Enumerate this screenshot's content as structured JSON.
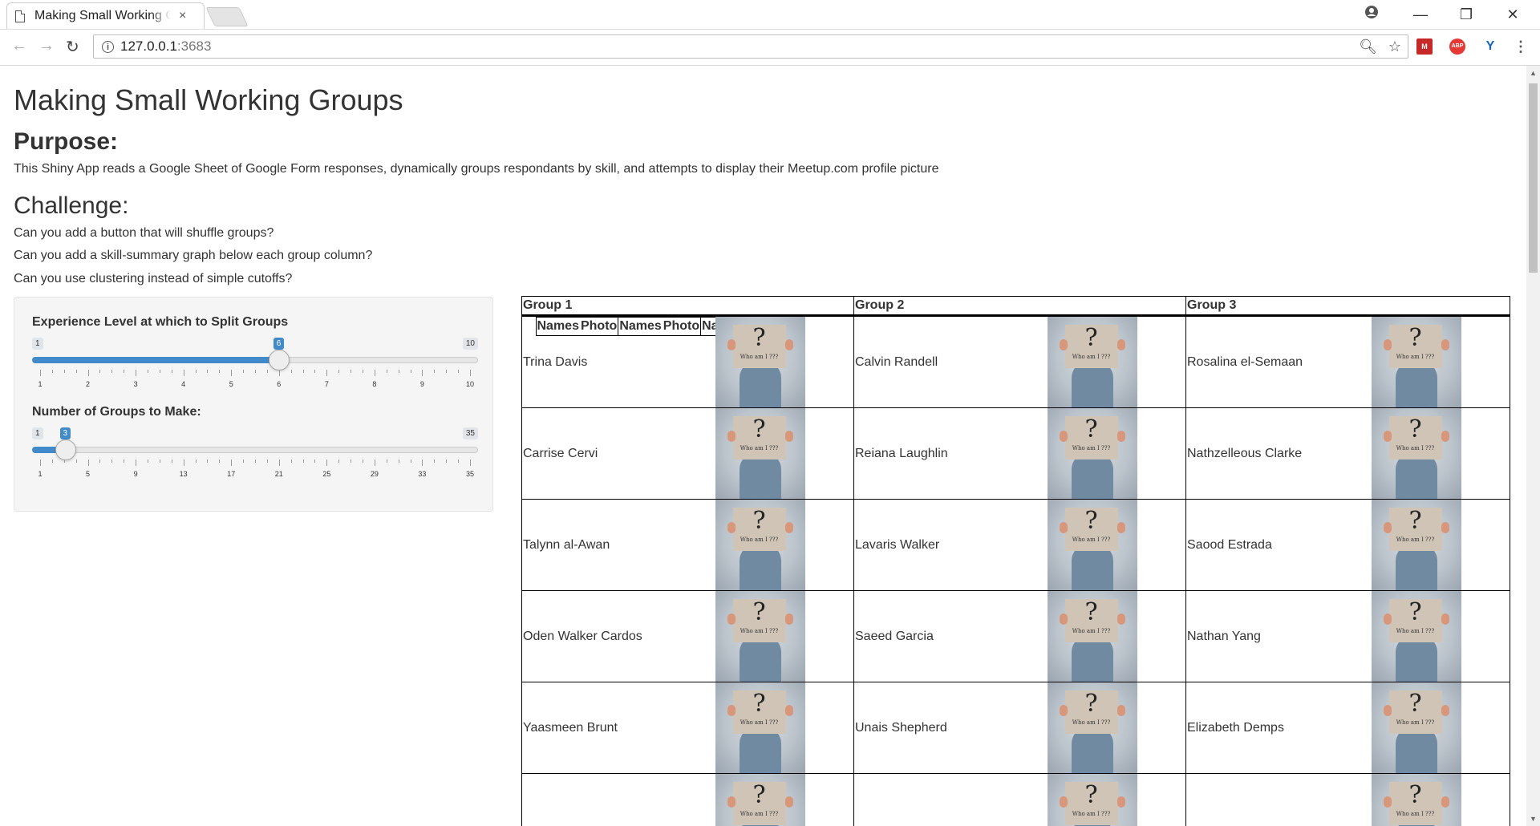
{
  "browser": {
    "tab_title": "Making Small Working G",
    "tab_close": "×",
    "url_host": "127.0.0.1",
    "url_port": ":3683",
    "ext_m": "M",
    "ext_abp": "ABP",
    "ext_y": "Y",
    "win_min": "—",
    "win_restore": "❐",
    "win_close": "✕"
  },
  "page": {
    "title": "Making Small Working Groups",
    "purpose_heading": "Purpose:",
    "purpose_text": "This Shiny App reads a Google Sheet of Google Form responses, dynamically groups respondants by skill, and attempts to display their Meetup.com profile picture",
    "challenge_heading": "Challenge:",
    "challenges": [
      "Can you add a button that will shuffle groups?",
      "Can you add a skill-summary graph below each group column?",
      "Can you use clustering instead of simple cutoffs?"
    ]
  },
  "sliders": [
    {
      "label": "Experience Level at which to Split Groups",
      "min": 1,
      "max": 10,
      "value": 6,
      "tick_labels": [
        "1",
        "2",
        "3",
        "4",
        "5",
        "6",
        "7",
        "8",
        "9",
        "10"
      ]
    },
    {
      "label": "Number of Groups to Make:",
      "min": 1,
      "max": 35,
      "value": 3,
      "tick_labels": [
        "1",
        "5",
        "9",
        "13",
        "17",
        "21",
        "25",
        "29",
        "33",
        "35"
      ]
    }
  ],
  "table": {
    "group_headers": [
      "Group 1",
      "Group 2",
      "Group 3"
    ],
    "col_names": "Names",
    "col_photo": "Photo",
    "photo_question": "?",
    "photo_caption": "Who am I ???",
    "rows": [
      [
        "Trina Davis",
        "Calvin Randell",
        "Rosalina el-Semaan"
      ],
      [
        "Carrise Cervi",
        "Reiana Laughlin",
        "Nathzelleous Clarke"
      ],
      [
        "Talynn al-Awan",
        "Lavaris Walker",
        "Saood Estrada"
      ],
      [
        "Oden Walker Cardos",
        "Saeed Garcia",
        "Nathan Yang"
      ],
      [
        "Yaasmeen Brunt",
        "Unais Shepherd",
        "Elizabeth Demps"
      ],
      [
        "",
        "",
        ""
      ]
    ]
  },
  "colors": {
    "accent": "#428bca",
    "well": "#f5f5f5"
  }
}
